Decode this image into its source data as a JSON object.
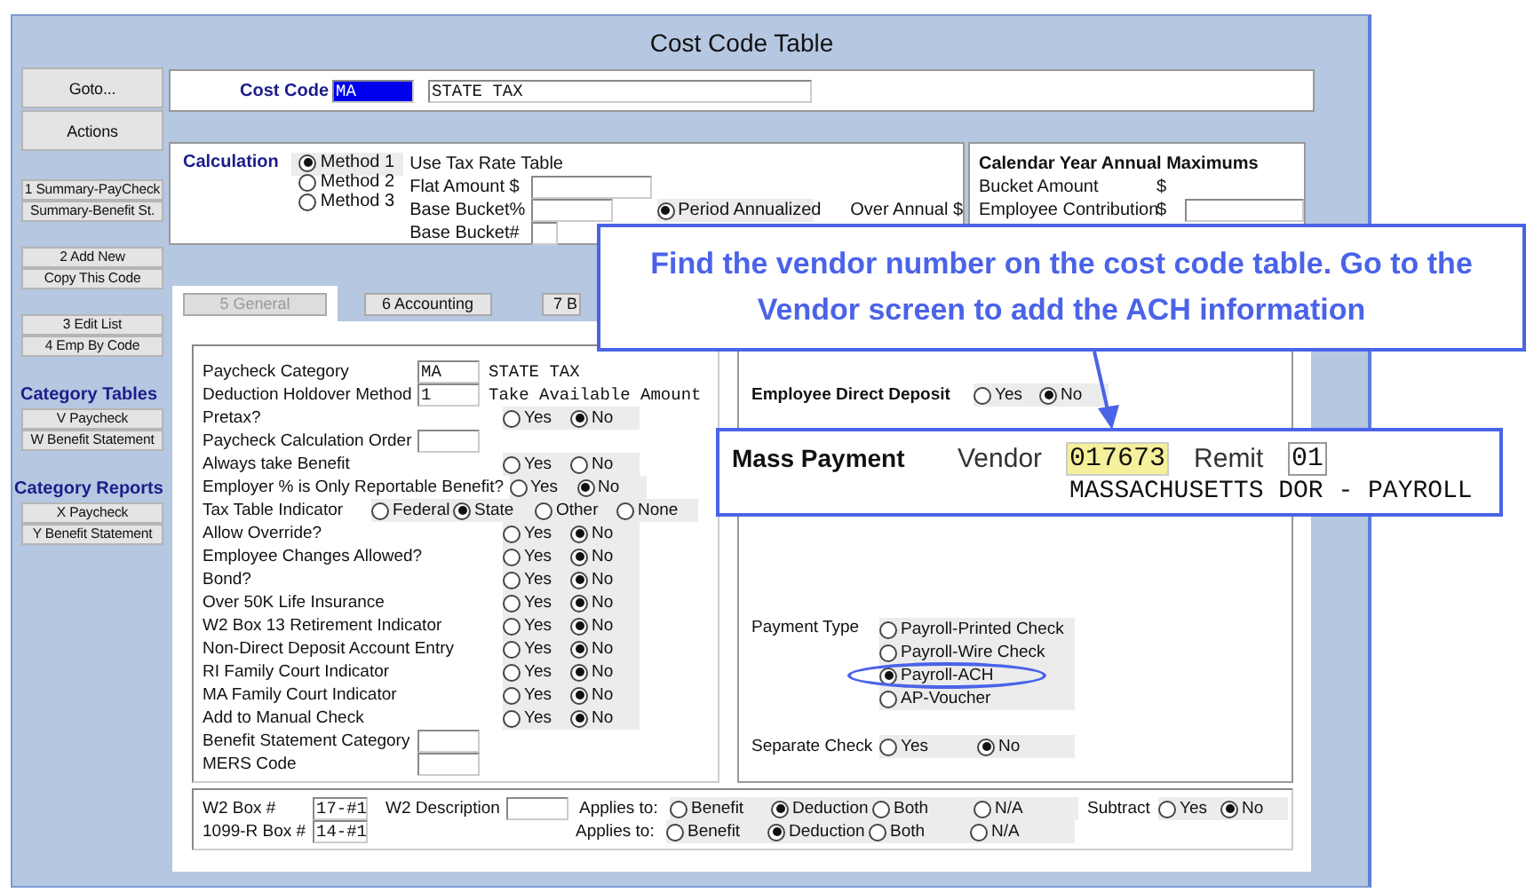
{
  "window": {
    "title": "Cost Code Table"
  },
  "sidebar": [
    {
      "kind": "large",
      "buttons": [
        "Goto...",
        "Actions"
      ]
    },
    {
      "kind": "small",
      "buttons": [
        "1 Summary-PayCheck",
        "Summary-Benefit St."
      ]
    },
    {
      "kind": "small",
      "buttons": [
        "2 Add New",
        "Copy This Code"
      ]
    },
    {
      "kind": "small",
      "buttons": [
        "3 Edit List",
        "4 Emp By Code"
      ]
    },
    {
      "kind": "small",
      "heading": "Category Tables",
      "buttons": [
        "V Paycheck",
        "W Benefit Statement"
      ]
    },
    {
      "kind": "small",
      "heading": "Category Reports",
      "buttons": [
        "X Paycheck",
        "Y Benefit Statement"
      ]
    }
  ],
  "cost_code": {
    "label": "Cost Code",
    "code": "MA",
    "code_selected": true,
    "description": "STATE TAX"
  },
  "calculation": {
    "label": "Calculation",
    "methods": [
      {
        "label": "Method 1",
        "selected": true
      },
      {
        "label": "Method 2",
        "selected": false
      },
      {
        "label": "Method 3",
        "selected": false
      }
    ],
    "use_tax_rate_table": "Use Tax Rate Table",
    "flat_amount": "Flat Amount $",
    "base_bucket_pct": "Base Bucket%",
    "base_bucket_num": "Base Bucket#",
    "period_annualized": {
      "label": "Period Annualized",
      "selected": true
    },
    "over_annual": "Over Annual $"
  },
  "annual_maximums": {
    "title": "Calendar Year Annual Maximums",
    "bucket_amount": "Bucket Amount",
    "bucket_amount_unit": "$",
    "employee_contribution": "Employee Contribution",
    "employee_contribution_unit": "$"
  },
  "tabs": [
    {
      "label": "5 General",
      "selected": true
    },
    {
      "label": "6 Accounting",
      "selected": false
    },
    {
      "label": "7 B",
      "selected": false
    }
  ],
  "general": {
    "rows": [
      {
        "kind": "field",
        "label": "Paycheck Category",
        "value": "MA",
        "note": "STATE TAX"
      },
      {
        "kind": "field",
        "label": "Deduction Holdover Method",
        "value": "1",
        "note": "Take Available Amount"
      },
      {
        "kind": "yesno",
        "label": "Pretax?",
        "options": [
          {
            "label": "Yes",
            "selected": false
          },
          {
            "label": "No",
            "selected": true
          }
        ]
      },
      {
        "kind": "field",
        "label": "Paycheck Calculation Order"
      },
      {
        "kind": "yesno",
        "label": "Always take Benefit",
        "options": [
          {
            "label": "Yes",
            "selected": false
          },
          {
            "label": "No",
            "selected": false
          }
        ]
      },
      {
        "kind": "yesno",
        "label": "Employer % is Only Reportable Benefit?",
        "options": [
          {
            "label": "Yes",
            "selected": false
          },
          {
            "label": "No",
            "selected": true
          }
        ]
      },
      {
        "kind": "multi",
        "label": "Tax Table Indicator",
        "options": [
          {
            "label": "Federal",
            "selected": false
          },
          {
            "label": "State",
            "selected": true
          },
          {
            "label": "Other",
            "selected": false
          },
          {
            "label": "None",
            "selected": false
          }
        ]
      },
      {
        "kind": "yesno",
        "label": "Allow Override?",
        "options": [
          {
            "label": "Yes",
            "selected": false
          },
          {
            "label": "No",
            "selected": true
          }
        ]
      },
      {
        "kind": "yesno",
        "label": "Employee Changes Allowed?",
        "options": [
          {
            "label": "Yes",
            "selected": false
          },
          {
            "label": "No",
            "selected": true
          }
        ]
      },
      {
        "kind": "yesno",
        "label": "Bond?",
        "options": [
          {
            "label": "Yes",
            "selected": false
          },
          {
            "label": "No",
            "selected": true
          }
        ]
      },
      {
        "kind": "yesno",
        "label": "Over 50K Life Insurance",
        "options": [
          {
            "label": "Yes",
            "selected": false
          },
          {
            "label": "No",
            "selected": true
          }
        ]
      },
      {
        "kind": "yesno",
        "label": "W2 Box 13 Retirement Indicator",
        "options": [
          {
            "label": "Yes",
            "selected": false
          },
          {
            "label": "No",
            "selected": true
          }
        ]
      },
      {
        "kind": "yesno",
        "label": "Non-Direct Deposit Account Entry",
        "options": [
          {
            "label": "Yes",
            "selected": false
          },
          {
            "label": "No",
            "selected": true
          }
        ]
      },
      {
        "kind": "yesno",
        "label": "RI Family Court Indicator",
        "options": [
          {
            "label": "Yes",
            "selected": false
          },
          {
            "label": "No",
            "selected": true
          }
        ]
      },
      {
        "kind": "yesno",
        "label": "MA Family Court Indicator",
        "options": [
          {
            "label": "Yes",
            "selected": false
          },
          {
            "label": "No",
            "selected": true
          }
        ]
      },
      {
        "kind": "yesno",
        "label": "Add to Manual Check",
        "options": [
          {
            "label": "Yes",
            "selected": false
          },
          {
            "label": "No",
            "selected": true
          }
        ]
      },
      {
        "kind": "field",
        "label": "Benefit Statement Category"
      },
      {
        "kind": "field",
        "label": "MERS Code"
      }
    ]
  },
  "direct_deposit": {
    "label": "Employee Direct Deposit",
    "options": [
      {
        "label": "Yes",
        "selected": false
      },
      {
        "label": "No",
        "selected": true
      }
    ]
  },
  "payment_type": {
    "label": "Payment Type",
    "options": [
      {
        "label": "Payroll-Printed Check",
        "selected": false
      },
      {
        "label": "Payroll-Wire Check",
        "selected": false
      },
      {
        "label": "Payroll-ACH",
        "selected": true
      },
      {
        "label": "AP-Voucher",
        "selected": false
      }
    ]
  },
  "separate_check": {
    "label": "Separate Check",
    "options": [
      {
        "label": "Yes",
        "selected": false
      },
      {
        "label": "No",
        "selected": true
      }
    ]
  },
  "boxes": [
    {
      "label": "W2 Box #",
      "value": "17-#1",
      "description_label": "W2 Description",
      "applies_label": "Applies to:",
      "applies": [
        {
          "label": "Benefit",
          "selected": false
        },
        {
          "label": "Deduction",
          "selected": true
        },
        {
          "label": "Both",
          "selected": false
        },
        {
          "label": "N/A",
          "selected": false
        }
      ],
      "subtract": {
        "label": "Subtract",
        "options": [
          {
            "label": "Yes",
            "selected": false
          },
          {
            "label": "No",
            "selected": true
          }
        ]
      }
    },
    {
      "label": "1099-R Box #",
      "value": "14-#1",
      "applies_label": "Applies to:",
      "applies": [
        {
          "label": "Benefit",
          "selected": false
        },
        {
          "label": "Deduction",
          "selected": true
        },
        {
          "label": "Both",
          "selected": false
        },
        {
          "label": "N/A",
          "selected": false
        }
      ]
    }
  ],
  "callout": "Find the vendor number on the cost code table. Go to the Vendor screen to add the ACH information",
  "mass_payment": {
    "title": "Mass Payment",
    "vendor_label": "Vendor",
    "vendor": "017673",
    "remit_label": "Remit",
    "remit": "01",
    "vendor_name": "MASSACHUSETTS DOR - PAYROLL"
  }
}
